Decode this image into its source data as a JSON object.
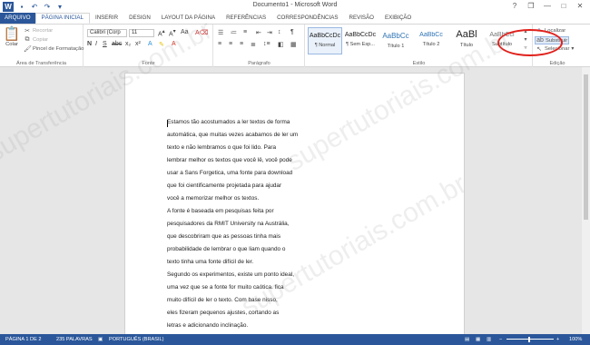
{
  "window": {
    "title": "Documento1 - Microsoft Word",
    "controls": [
      "?",
      "❐",
      "—",
      "□",
      "✕"
    ]
  },
  "quick_access": [
    "save-icon",
    "undo-icon",
    "redo-icon",
    "customize-icon"
  ],
  "tabs": [
    {
      "label": "ARQUIVO"
    },
    {
      "label": "PÁGINA INICIAL"
    },
    {
      "label": "INSERIR"
    },
    {
      "label": "DESIGN"
    },
    {
      "label": "LAYOUT DA PÁGINA"
    },
    {
      "label": "REFERÊNCIAS"
    },
    {
      "label": "CORRESPONDÊNCIAS"
    },
    {
      "label": "REVISÃO"
    },
    {
      "label": "EXIBIÇÃO"
    }
  ],
  "clipboard": {
    "paste": "Colar",
    "cut": "Recortar",
    "copy": "Copiar",
    "format_painter": "Pincel de Formatação",
    "label": "Área de Transferência"
  },
  "font": {
    "name": "Calibri (Corp",
    "size": "11",
    "label": "Fonte"
  },
  "paragraph": {
    "label": "Parágrafo"
  },
  "styles": {
    "label": "Estilo",
    "items": [
      {
        "preview": "AaBbCcDc",
        "name": "¶ Normal"
      },
      {
        "preview": "AaBbCcDc",
        "name": "¶ Sem Esp..."
      },
      {
        "preview": "AaBbCc",
        "name": "Título 1"
      },
      {
        "preview": "AaBbCc",
        "name": "Título 2"
      },
      {
        "preview": "AaBl",
        "name": "Título"
      },
      {
        "preview": "AaBbCcl",
        "name": "Subtítulo"
      }
    ]
  },
  "editing": {
    "find": "Localizar",
    "replace": "Substituir",
    "select": "Selecionar",
    "label": "Edição"
  },
  "document": {
    "lines": [
      "Estamos tão acostumados a ler textos de forma",
      "automática, que muitas vezes acabamos de ler um",
      "texto e não lembramos o que foi lido. Para",
      "lembrar melhor os textos que você lê, você pode",
      "usar a Sans Forgetica, uma fonte para download",
      "que foi cientificamente projetada para ajudar",
      "você a memorizar melhor os textos.",
      "A fonte é baseada em pesquisas feita por",
      "pesquisadores da RMIT University na Austrália,",
      "que descobriram que as pessoas tinha mais",
      "probabilidade de lembrar o que liam quando o",
      "texto tinha uma fonte difícil de ler.",
      "Segundo os experimentos, existe um ponto ideal,",
      "uma vez que se a fonte for muito caótica. fica",
      "muito difícil de ler o texto. Com base nisso,",
      "eles fizeram pequenos ajustes, cortando as",
      "letras e adicionando inclinação."
    ]
  },
  "watermark": [
    "supertutoriais.com.br",
    "supertutoriais.com.br",
    "supertutoriais.com.br"
  ],
  "status": {
    "page": "PÁGINA 1 DE 2",
    "words": "235 PALAVRAS",
    "language": "PORTUGUÊS (BRASIL)",
    "zoom": "100%"
  },
  "colors": {
    "accent": "#2b579a",
    "highlight": "#e0201b"
  }
}
